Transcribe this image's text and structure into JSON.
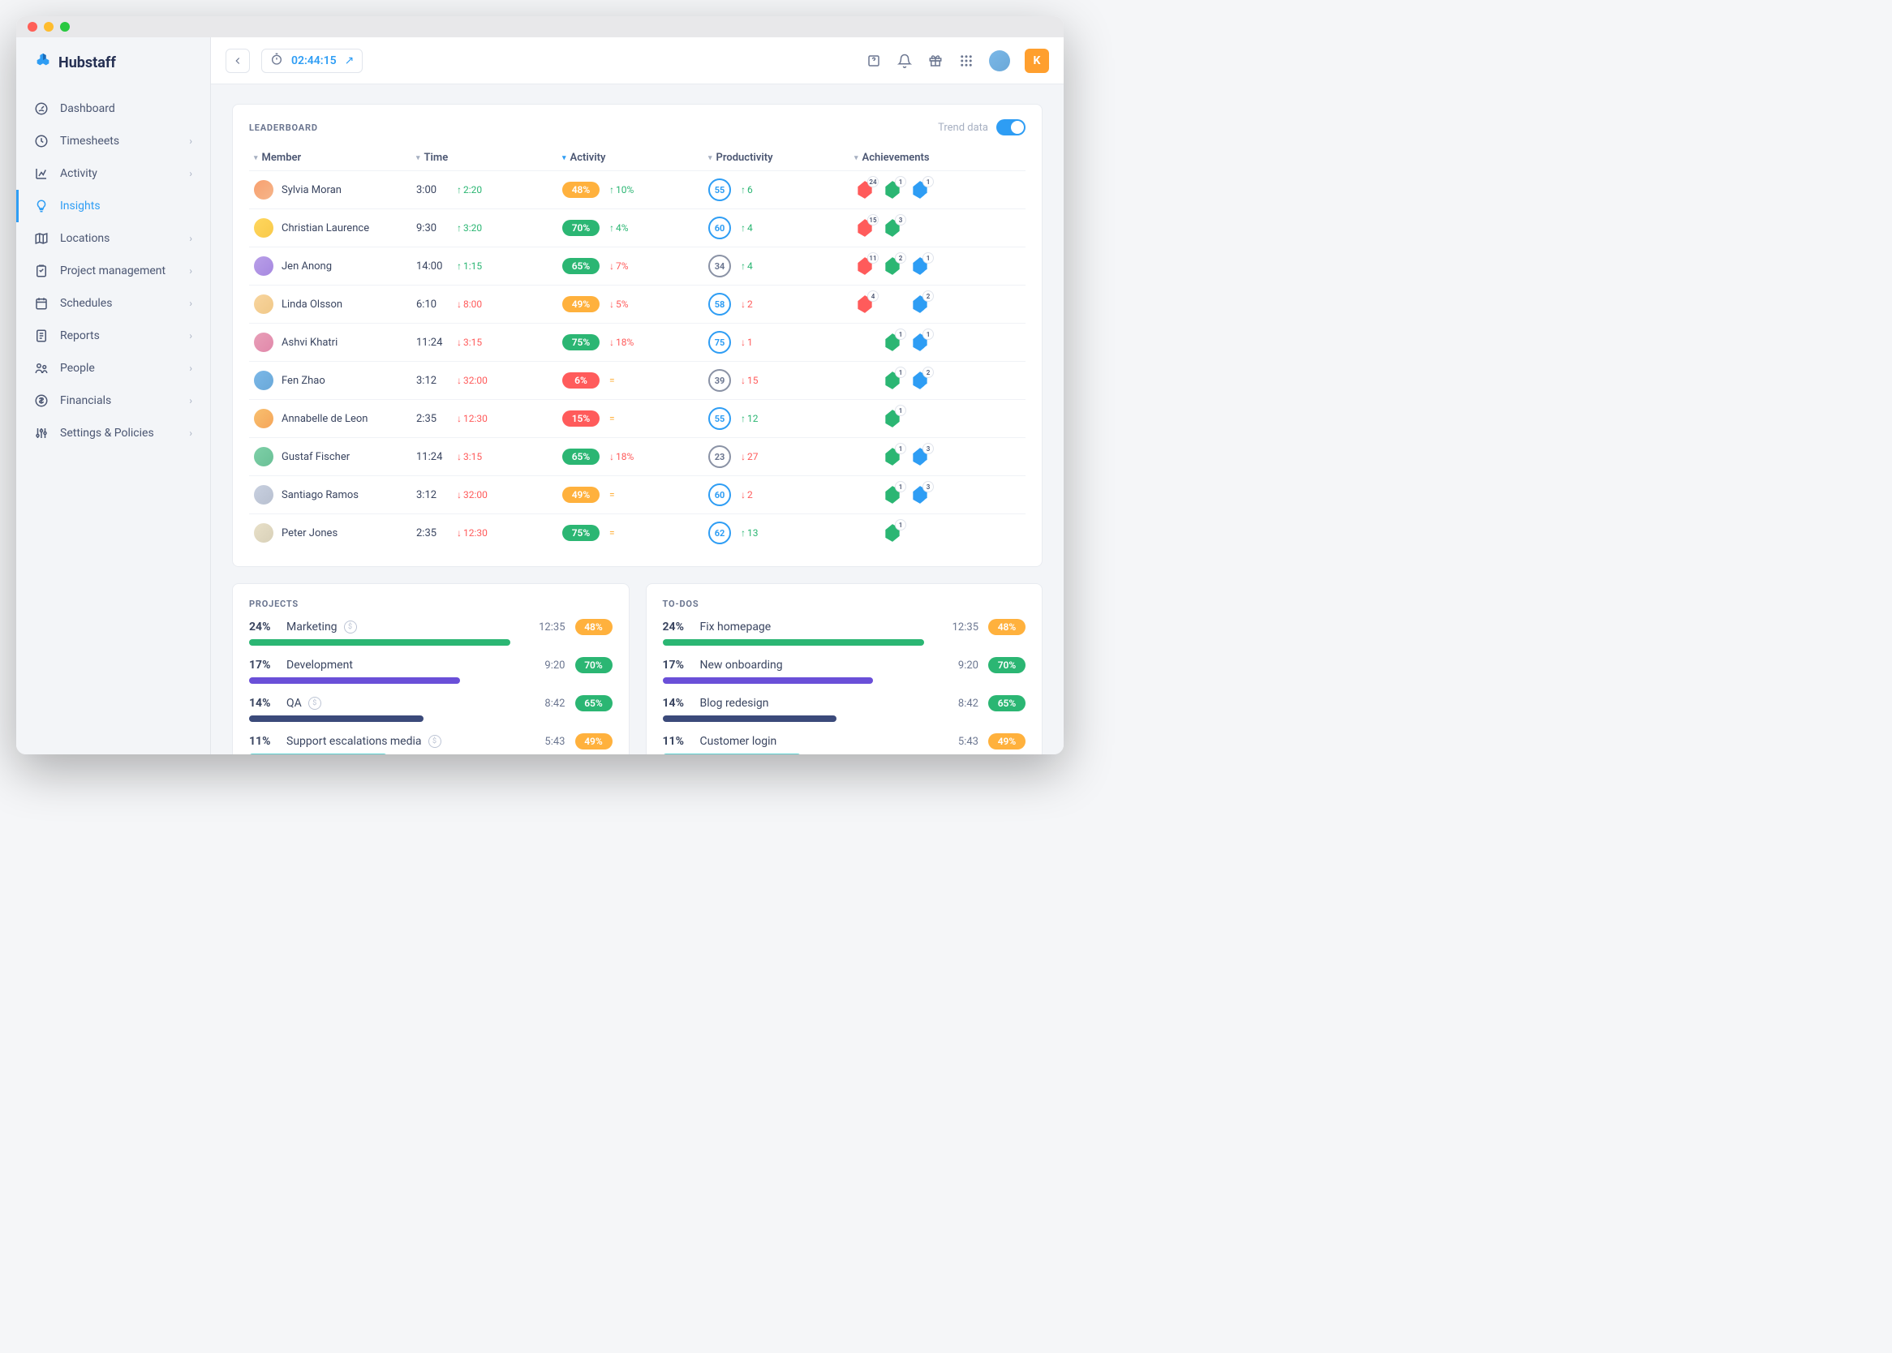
{
  "brand": "Hubstaff",
  "timer": "02:44:15",
  "user_initial": "K",
  "sidebar": {
    "items": [
      {
        "label": "Dashboard",
        "icon": "gauge",
        "chev": false
      },
      {
        "label": "Timesheets",
        "icon": "clock",
        "chev": true
      },
      {
        "label": "Activity",
        "icon": "chart",
        "chev": true
      },
      {
        "label": "Insights",
        "icon": "bulb",
        "chev": false,
        "active": true
      },
      {
        "label": "Locations",
        "icon": "map",
        "chev": true
      },
      {
        "label": "Project management",
        "icon": "clipboard",
        "chev": true
      },
      {
        "label": "Schedules",
        "icon": "calendar",
        "chev": true
      },
      {
        "label": "Reports",
        "icon": "file",
        "chev": true
      },
      {
        "label": "People",
        "icon": "people",
        "chev": true
      },
      {
        "label": "Financials",
        "icon": "dollar",
        "chev": true
      },
      {
        "label": "Settings & Policies",
        "icon": "sliders",
        "chev": true
      }
    ]
  },
  "leaderboard": {
    "title": "LEADERBOARD",
    "trend_label": "Trend data",
    "columns": [
      "Member",
      "Time",
      "Activity",
      "Productivity",
      "Achievements"
    ],
    "rows": [
      {
        "name": "Sylvia Moran",
        "avatar": "c1",
        "time": "3:00",
        "time_delta": "2:20",
        "time_dir": "up",
        "activity": "48%",
        "act_color": "orange",
        "act_delta": "10%",
        "act_dir": "up",
        "prod": "55",
        "prod_color": "blue",
        "prod_delta": "6",
        "prod_dir": "up",
        "ach": [
          {
            "c": "red",
            "n": "24",
            "i": "fire"
          },
          {
            "c": "green",
            "n": "1",
            "i": "check"
          },
          {
            "c": "blue",
            "n": "1",
            "i": "clock"
          }
        ]
      },
      {
        "name": "Christian Laurence",
        "avatar": "c2",
        "time": "9:30",
        "time_delta": "3:20",
        "time_dir": "up",
        "activity": "70%",
        "act_color": "green",
        "act_delta": "4%",
        "act_dir": "up",
        "prod": "60",
        "prod_color": "blue",
        "prod_delta": "4",
        "prod_dir": "up",
        "ach": [
          {
            "c": "red",
            "n": "15",
            "i": "fire"
          },
          {
            "c": "green",
            "n": "3",
            "i": "check"
          }
        ]
      },
      {
        "name": "Jen Anong",
        "avatar": "c3",
        "time": "14:00",
        "time_delta": "1:15",
        "time_dir": "up",
        "activity": "65%",
        "act_color": "green",
        "act_delta": "7%",
        "act_dir": "down",
        "prod": "34",
        "prod_color": "gray",
        "prod_delta": "4",
        "prod_dir": "up",
        "ach": [
          {
            "c": "red",
            "n": "11",
            "i": "fire"
          },
          {
            "c": "green",
            "n": "2",
            "i": "check"
          },
          {
            "c": "blue",
            "n": "1",
            "i": "clock"
          }
        ]
      },
      {
        "name": "Linda Olsson",
        "avatar": "c4",
        "time": "6:10",
        "time_delta": "8:00",
        "time_dir": "down",
        "activity": "49%",
        "act_color": "orange",
        "act_delta": "5%",
        "act_dir": "down",
        "prod": "58",
        "prod_color": "blue",
        "prod_delta": "2",
        "prod_dir": "down",
        "ach": [
          {
            "c": "red",
            "n": "4",
            "i": "fire"
          },
          null,
          {
            "c": "blue",
            "n": "2",
            "i": "clock"
          }
        ]
      },
      {
        "name": "Ashvi Khatri",
        "avatar": "c5",
        "time": "11:24",
        "time_delta": "3:15",
        "time_dir": "down",
        "activity": "75%",
        "act_color": "green",
        "act_delta": "18%",
        "act_dir": "down",
        "prod": "75",
        "prod_color": "blue",
        "prod_delta": "1",
        "prod_dir": "down",
        "ach": [
          null,
          {
            "c": "green",
            "n": "1",
            "i": "check"
          },
          {
            "c": "blue",
            "n": "1",
            "i": "clock"
          }
        ]
      },
      {
        "name": "Fen Zhao",
        "avatar": "c6",
        "time": "3:12",
        "time_delta": "32:00",
        "time_dir": "down",
        "activity": "6%",
        "act_color": "red",
        "act_delta": "=",
        "act_dir": "eq",
        "prod": "39",
        "prod_color": "gray",
        "prod_delta": "15",
        "prod_dir": "down",
        "ach": [
          null,
          {
            "c": "green",
            "n": "1",
            "i": "check"
          },
          {
            "c": "blue",
            "n": "2",
            "i": "clock"
          }
        ]
      },
      {
        "name": "Annabelle de Leon",
        "avatar": "c7",
        "time": "2:35",
        "time_delta": "12:30",
        "time_dir": "down",
        "activity": "15%",
        "act_color": "red",
        "act_delta": "=",
        "act_dir": "eq",
        "prod": "55",
        "prod_color": "blue",
        "prod_delta": "12",
        "prod_dir": "up",
        "ach": [
          null,
          {
            "c": "green",
            "n": "1",
            "i": "check"
          }
        ]
      },
      {
        "name": "Gustaf Fischer",
        "avatar": "c8",
        "time": "11:24",
        "time_delta": "3:15",
        "time_dir": "down",
        "activity": "65%",
        "act_color": "green",
        "act_delta": "18%",
        "act_dir": "down",
        "prod": "23",
        "prod_color": "gray",
        "prod_delta": "27",
        "prod_dir": "down",
        "ach": [
          null,
          {
            "c": "green",
            "n": "1",
            "i": "check"
          },
          {
            "c": "blue",
            "n": "3",
            "i": "clock"
          }
        ]
      },
      {
        "name": "Santiago Ramos",
        "avatar": "c9",
        "time": "3:12",
        "time_delta": "32:00",
        "time_dir": "down",
        "activity": "49%",
        "act_color": "orange",
        "act_delta": "=",
        "act_dir": "eq",
        "prod": "60",
        "prod_color": "blue",
        "prod_delta": "2",
        "prod_dir": "down",
        "ach": [
          null,
          {
            "c": "green",
            "n": "1",
            "i": "check"
          },
          {
            "c": "blue",
            "n": "3",
            "i": "clock"
          }
        ]
      },
      {
        "name": "Peter Jones",
        "avatar": "c10",
        "time": "2:35",
        "time_delta": "12:30",
        "time_dir": "down",
        "activity": "75%",
        "act_color": "green",
        "act_delta": "=",
        "act_dir": "eq",
        "prod": "62",
        "prod_color": "blue",
        "prod_delta": "13",
        "prod_dir": "up",
        "ach": [
          null,
          {
            "c": "green",
            "n": "1",
            "i": "check"
          }
        ]
      }
    ]
  },
  "projects": {
    "title": "PROJECTS",
    "items": [
      {
        "pct": "24%",
        "name": "Marketing",
        "money": true,
        "time": "12:35",
        "pill": "48%",
        "pill_color": "orange",
        "bar": 72,
        "bar_color": "green"
      },
      {
        "pct": "17%",
        "name": "Development",
        "money": false,
        "time": "9:20",
        "pill": "70%",
        "pill_color": "green",
        "bar": 58,
        "bar_color": "purple"
      },
      {
        "pct": "14%",
        "name": "QA",
        "money": true,
        "time": "8:42",
        "pill": "65%",
        "pill_color": "green",
        "bar": 48,
        "bar_color": "navy"
      },
      {
        "pct": "11%",
        "name": "Support escalations media",
        "money": true,
        "time": "5:43",
        "pill": "49%",
        "pill_color": "orange",
        "bar": 38,
        "bar_color": "teal"
      }
    ]
  },
  "todos": {
    "title": "TO-DOS",
    "items": [
      {
        "pct": "24%",
        "name": "Fix homepage",
        "money": false,
        "time": "12:35",
        "pill": "48%",
        "pill_color": "orange",
        "bar": 72,
        "bar_color": "green"
      },
      {
        "pct": "17%",
        "name": "New onboarding",
        "money": false,
        "time": "9:20",
        "pill": "70%",
        "pill_color": "green",
        "bar": 58,
        "bar_color": "purple"
      },
      {
        "pct": "14%",
        "name": "Blog redesign",
        "money": false,
        "time": "8:42",
        "pill": "65%",
        "pill_color": "green",
        "bar": 48,
        "bar_color": "navy"
      },
      {
        "pct": "11%",
        "name": "Customer login",
        "money": false,
        "time": "5:43",
        "pill": "49%",
        "pill_color": "orange",
        "bar": 38,
        "bar_color": "teal"
      }
    ]
  }
}
